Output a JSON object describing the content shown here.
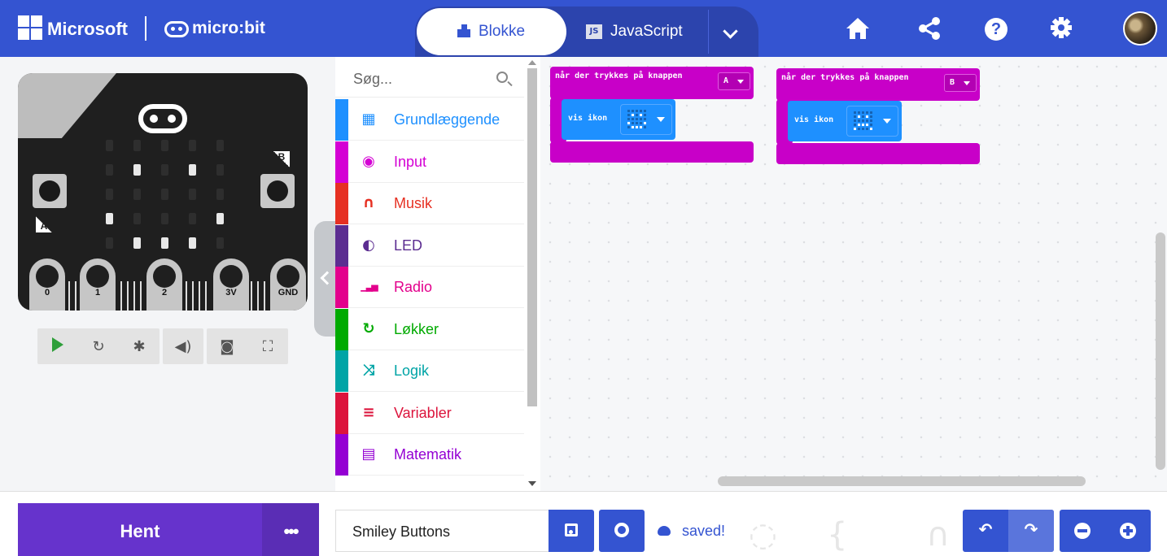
{
  "header": {
    "brand": "Microsoft",
    "product": "micro:bit",
    "tabs": [
      {
        "label": "Blokke",
        "active": true
      },
      {
        "label": "JavaScript",
        "active": false,
        "badge": "JS"
      }
    ],
    "icons": [
      "home-icon",
      "share-icon",
      "help-icon",
      "gear-icon",
      "avatar"
    ],
    "help_glyph": "?"
  },
  "simulator": {
    "button_a": "A",
    "button_b": "B",
    "pins": [
      "0",
      "1",
      "2",
      "3V",
      "GND"
    ],
    "led_matrix": [
      [
        0,
        0,
        0,
        0,
        0
      ],
      [
        0,
        1,
        0,
        1,
        0
      ],
      [
        0,
        0,
        0,
        0,
        0
      ],
      [
        1,
        0,
        0,
        0,
        1
      ],
      [
        0,
        1,
        1,
        1,
        0
      ]
    ],
    "toolbar": [
      "play-icon",
      "restart-icon",
      "debug-icon",
      "sound-icon",
      "screenshot-icon",
      "fullscreen-icon"
    ]
  },
  "toolbox": {
    "search_placeholder": "Søg...",
    "categories": [
      {
        "label": "Grundlæggende",
        "color": "#1e90ff",
        "icon": "grid-icon"
      },
      {
        "label": "Input",
        "color": "#d400d4",
        "icon": "target-icon"
      },
      {
        "label": "Musik",
        "color": "#e63022",
        "icon": "headphones-icon"
      },
      {
        "label": "LED",
        "color": "#5c2d91",
        "icon": "toggle-icon"
      },
      {
        "label": "Radio",
        "color": "#e3008c",
        "icon": "signal-icon"
      },
      {
        "label": "Løkker",
        "color": "#00aa00",
        "icon": "loop-icon"
      },
      {
        "label": "Logik",
        "color": "#00a4a6",
        "icon": "shuffle-icon"
      },
      {
        "label": "Variabler",
        "color": "#dc143c",
        "icon": "list-icon"
      },
      {
        "label": "Matematik",
        "color": "#9400d3",
        "icon": "calculator-icon"
      }
    ]
  },
  "workspace": {
    "blocks": [
      {
        "event": "når der trykkes på knappen",
        "button": "A",
        "statement": "vis ikon",
        "icon": [
          [
            0,
            0,
            0,
            0,
            0
          ],
          [
            0,
            1,
            0,
            1,
            0
          ],
          [
            0,
            0,
            0,
            0,
            0
          ],
          [
            1,
            0,
            0,
            0,
            1
          ],
          [
            0,
            1,
            1,
            1,
            0
          ]
        ]
      },
      {
        "event": "når der trykkes på knappen",
        "button": "B",
        "statement": "vis ikon",
        "icon": [
          [
            0,
            0,
            0,
            0,
            0
          ],
          [
            0,
            1,
            0,
            1,
            0
          ],
          [
            0,
            0,
            0,
            0,
            0
          ],
          [
            0,
            1,
            1,
            1,
            0
          ],
          [
            1,
            0,
            0,
            0,
            1
          ]
        ]
      }
    ]
  },
  "footer": {
    "download_label": "Hent",
    "more_label": "•••",
    "project_name": "Smiley Buttons",
    "save_status": "saved!"
  },
  "colors": {
    "header_bg": "#3454d1",
    "download_bg": "#6633cc",
    "event_block": "#c800c8",
    "basic_block": "#1e90ff"
  }
}
